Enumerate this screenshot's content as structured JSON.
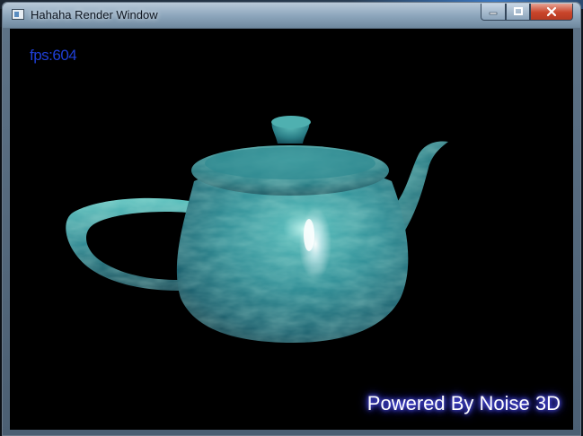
{
  "window": {
    "title": "Hahaha Render Window",
    "controls": {
      "minimize": "–",
      "maximize": "☐",
      "close": "✕"
    }
  },
  "viewport": {
    "fps_text": "fps:604",
    "overlay_text": "Powered By Noise 3D",
    "scene_object": "teapot-model",
    "colors": {
      "background": "#000000",
      "fps": "#1f3fd6",
      "overlay_glow": "#4a4cff"
    }
  }
}
